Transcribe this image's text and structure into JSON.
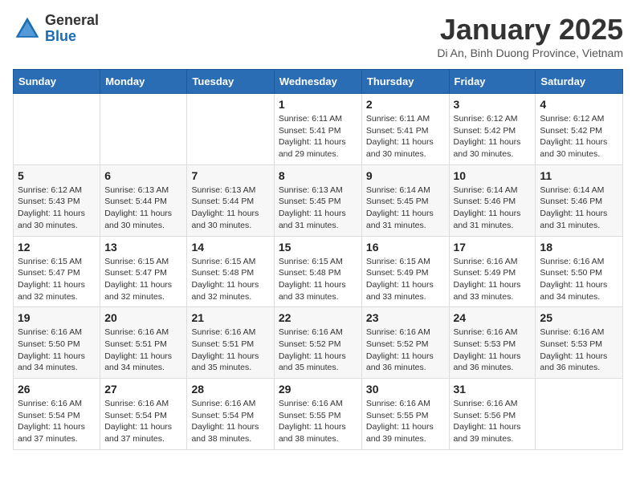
{
  "header": {
    "logo_general": "General",
    "logo_blue": "Blue",
    "month_title": "January 2025",
    "location": "Di An, Binh Duong Province, Vietnam"
  },
  "days_of_week": [
    "Sunday",
    "Monday",
    "Tuesday",
    "Wednesday",
    "Thursday",
    "Friday",
    "Saturday"
  ],
  "weeks": [
    [
      {
        "day": "",
        "info": ""
      },
      {
        "day": "",
        "info": ""
      },
      {
        "day": "",
        "info": ""
      },
      {
        "day": "1",
        "info": "Sunrise: 6:11 AM\nSunset: 5:41 PM\nDaylight: 11 hours and 29 minutes."
      },
      {
        "day": "2",
        "info": "Sunrise: 6:11 AM\nSunset: 5:41 PM\nDaylight: 11 hours and 30 minutes."
      },
      {
        "day": "3",
        "info": "Sunrise: 6:12 AM\nSunset: 5:42 PM\nDaylight: 11 hours and 30 minutes."
      },
      {
        "day": "4",
        "info": "Sunrise: 6:12 AM\nSunset: 5:42 PM\nDaylight: 11 hours and 30 minutes."
      }
    ],
    [
      {
        "day": "5",
        "info": "Sunrise: 6:12 AM\nSunset: 5:43 PM\nDaylight: 11 hours and 30 minutes."
      },
      {
        "day": "6",
        "info": "Sunrise: 6:13 AM\nSunset: 5:44 PM\nDaylight: 11 hours and 30 minutes."
      },
      {
        "day": "7",
        "info": "Sunrise: 6:13 AM\nSunset: 5:44 PM\nDaylight: 11 hours and 30 minutes."
      },
      {
        "day": "8",
        "info": "Sunrise: 6:13 AM\nSunset: 5:45 PM\nDaylight: 11 hours and 31 minutes."
      },
      {
        "day": "9",
        "info": "Sunrise: 6:14 AM\nSunset: 5:45 PM\nDaylight: 11 hours and 31 minutes."
      },
      {
        "day": "10",
        "info": "Sunrise: 6:14 AM\nSunset: 5:46 PM\nDaylight: 11 hours and 31 minutes."
      },
      {
        "day": "11",
        "info": "Sunrise: 6:14 AM\nSunset: 5:46 PM\nDaylight: 11 hours and 31 minutes."
      }
    ],
    [
      {
        "day": "12",
        "info": "Sunrise: 6:15 AM\nSunset: 5:47 PM\nDaylight: 11 hours and 32 minutes."
      },
      {
        "day": "13",
        "info": "Sunrise: 6:15 AM\nSunset: 5:47 PM\nDaylight: 11 hours and 32 minutes."
      },
      {
        "day": "14",
        "info": "Sunrise: 6:15 AM\nSunset: 5:48 PM\nDaylight: 11 hours and 32 minutes."
      },
      {
        "day": "15",
        "info": "Sunrise: 6:15 AM\nSunset: 5:48 PM\nDaylight: 11 hours and 33 minutes."
      },
      {
        "day": "16",
        "info": "Sunrise: 6:15 AM\nSunset: 5:49 PM\nDaylight: 11 hours and 33 minutes."
      },
      {
        "day": "17",
        "info": "Sunrise: 6:16 AM\nSunset: 5:49 PM\nDaylight: 11 hours and 33 minutes."
      },
      {
        "day": "18",
        "info": "Sunrise: 6:16 AM\nSunset: 5:50 PM\nDaylight: 11 hours and 34 minutes."
      }
    ],
    [
      {
        "day": "19",
        "info": "Sunrise: 6:16 AM\nSunset: 5:50 PM\nDaylight: 11 hours and 34 minutes."
      },
      {
        "day": "20",
        "info": "Sunrise: 6:16 AM\nSunset: 5:51 PM\nDaylight: 11 hours and 34 minutes."
      },
      {
        "day": "21",
        "info": "Sunrise: 6:16 AM\nSunset: 5:51 PM\nDaylight: 11 hours and 35 minutes."
      },
      {
        "day": "22",
        "info": "Sunrise: 6:16 AM\nSunset: 5:52 PM\nDaylight: 11 hours and 35 minutes."
      },
      {
        "day": "23",
        "info": "Sunrise: 6:16 AM\nSunset: 5:52 PM\nDaylight: 11 hours and 36 minutes."
      },
      {
        "day": "24",
        "info": "Sunrise: 6:16 AM\nSunset: 5:53 PM\nDaylight: 11 hours and 36 minutes."
      },
      {
        "day": "25",
        "info": "Sunrise: 6:16 AM\nSunset: 5:53 PM\nDaylight: 11 hours and 36 minutes."
      }
    ],
    [
      {
        "day": "26",
        "info": "Sunrise: 6:16 AM\nSunset: 5:54 PM\nDaylight: 11 hours and 37 minutes."
      },
      {
        "day": "27",
        "info": "Sunrise: 6:16 AM\nSunset: 5:54 PM\nDaylight: 11 hours and 37 minutes."
      },
      {
        "day": "28",
        "info": "Sunrise: 6:16 AM\nSunset: 5:54 PM\nDaylight: 11 hours and 38 minutes."
      },
      {
        "day": "29",
        "info": "Sunrise: 6:16 AM\nSunset: 5:55 PM\nDaylight: 11 hours and 38 minutes."
      },
      {
        "day": "30",
        "info": "Sunrise: 6:16 AM\nSunset: 5:55 PM\nDaylight: 11 hours and 39 minutes."
      },
      {
        "day": "31",
        "info": "Sunrise: 6:16 AM\nSunset: 5:56 PM\nDaylight: 11 hours and 39 minutes."
      },
      {
        "day": "",
        "info": ""
      }
    ]
  ]
}
